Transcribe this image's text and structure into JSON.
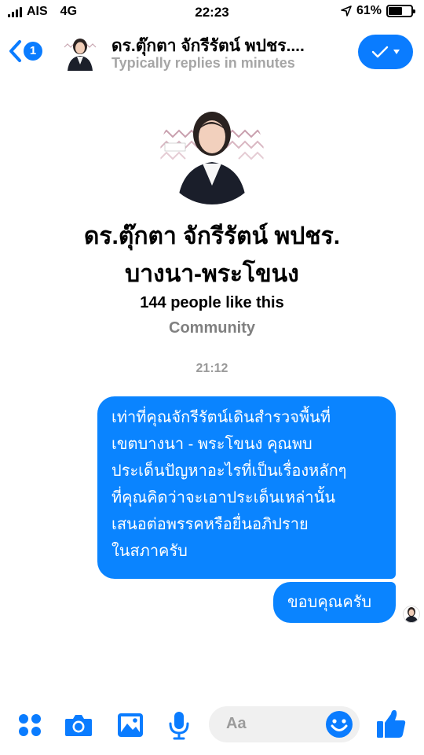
{
  "status_bar": {
    "carrier": "AIS",
    "network": "4G",
    "time": "22:23",
    "battery_percent": "61%",
    "battery_level": 0.61
  },
  "header": {
    "back_badge_count": "1",
    "contact_name": "ดร.ตุ๊กตา จักรีรัตน์ พปชร....",
    "contact_status": "Typically replies in minutes",
    "accent_color": "#0a7cff"
  },
  "profile": {
    "name_line1": "ดร.ตุ๊กตา จักรีรัตน์ พปชร.",
    "name_line2": "บางนา-พระโขนง",
    "likes": "144 people like this",
    "category": "Community"
  },
  "conversation": {
    "timestamp": "21:12",
    "messages": [
      {
        "lines": [
          "เท่าที่คุณจักรีรัตน์เดินสำรวจพื้นที่",
          "เขตบางนา - พระโขนง คุณพบ",
          "ประเด็นปัญหาอะไรที่เป็นเรื่องหลักๆ",
          "ที่คุณคิดว่าจะเอาประเด็นเหล่านั้น",
          "เสนอต่อพรรคหรือยื่นอภิปราย",
          "ในสภาครับ"
        ]
      },
      {
        "lines": [
          "ขอบคุณครับ"
        ]
      }
    ]
  },
  "composer": {
    "placeholder": "Aa",
    "icons": [
      "apps-icon",
      "camera-icon",
      "gallery-icon",
      "microphone-icon",
      "emoji-icon",
      "thumbs-up-icon"
    ]
  }
}
